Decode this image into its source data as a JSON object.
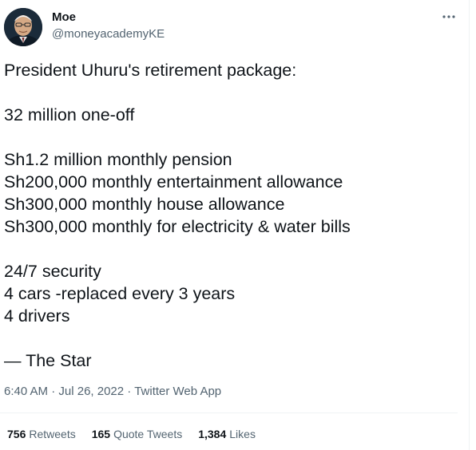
{
  "author": {
    "display_name": "Moe",
    "handle": "@moneyacademyKE"
  },
  "tweet": {
    "lines": [
      "President Uhuru's retirement package:",
      "",
      "32 million one-off",
      "",
      "Sh1.2 million monthly pension",
      "Sh200,000 monthly entertainment allowance",
      "Sh300,000 monthly house allowance",
      "Sh300,000 monthly for electricity & water bills",
      "",
      "24/7 security",
      "4 cars -replaced every 3 years",
      "4 drivers",
      "",
      "— The Star"
    ]
  },
  "meta": {
    "time": "6:40 AM",
    "separator": " · ",
    "date": "Jul 26, 2022",
    "source": "Twitter Web App"
  },
  "stats": {
    "retweets_count": "756",
    "retweets_label": "Retweets",
    "quotes_count": "165",
    "quotes_label": "Quote Tweets",
    "likes_count": "1,384",
    "likes_label": "Likes"
  },
  "icons": {
    "more": "more-horizontal-icon"
  },
  "colors": {
    "text_primary": "#0f1419",
    "text_secondary": "#536471",
    "border": "#eff3f4"
  }
}
